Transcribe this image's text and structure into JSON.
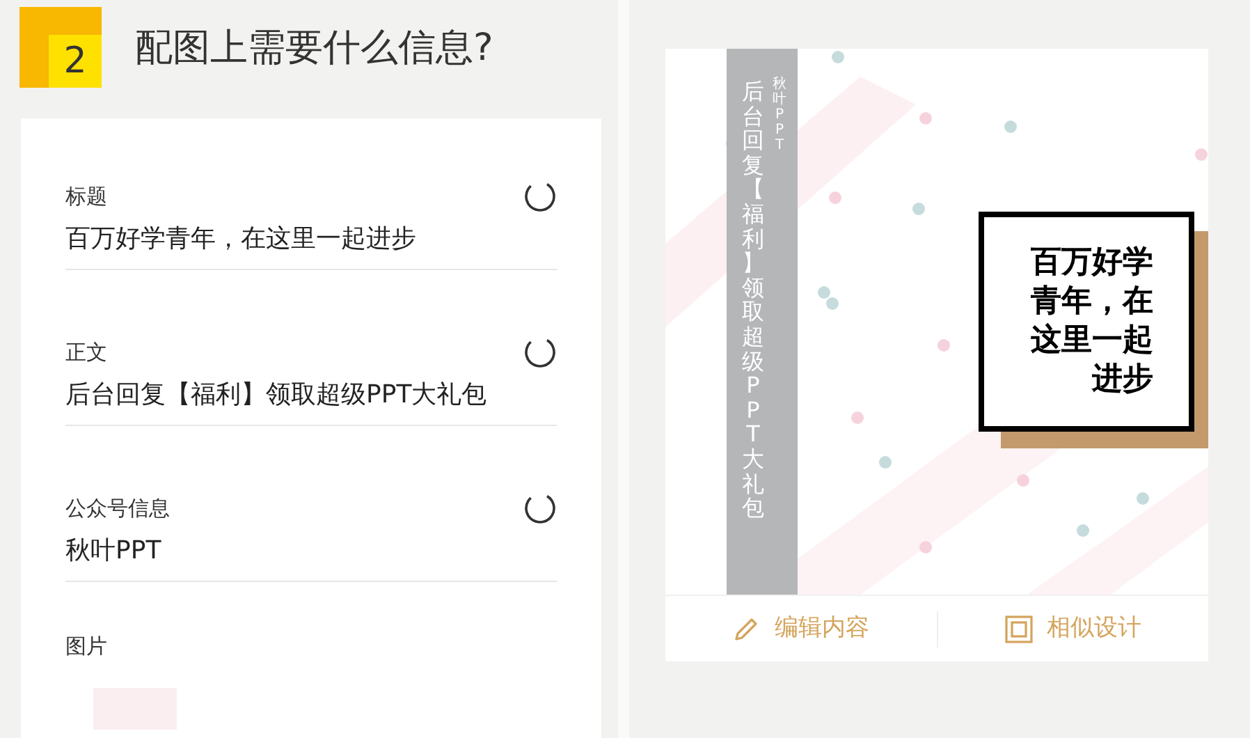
{
  "step": {
    "number": "2",
    "title": "配图上需要什么信息?"
  },
  "fields": [
    {
      "label": "标题",
      "value": "百万好学青年，在这里一起进步"
    },
    {
      "label": "正文",
      "value": "后台回复【福利】领取超级PPT大礼包"
    },
    {
      "label": "公众号信息",
      "value": "秋叶PPT"
    }
  ],
  "image_field": {
    "label": "图片"
  },
  "preview": {
    "brand": "秋叶PPT",
    "side_text": "后台回复【福利】领取超级PPT大礼包",
    "headline": "百万好学青年，在这里一起进步"
  },
  "actions": [
    {
      "label": "编辑内容",
      "kind": "edit"
    },
    {
      "label": "相似设计",
      "kind": "similar"
    }
  ]
}
